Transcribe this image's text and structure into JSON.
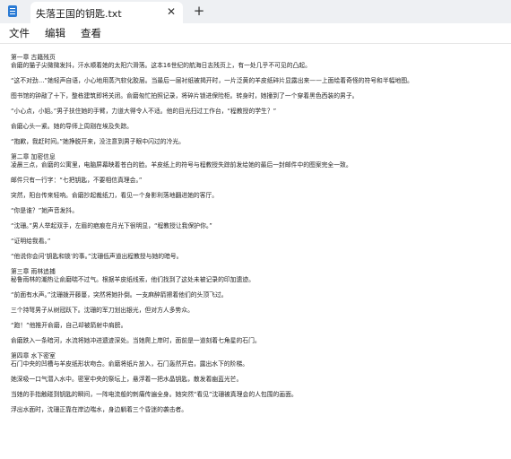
{
  "window": {
    "tab_title": "失落王国的钥匙.txt",
    "close_glyph": "✕",
    "new_tab_glyph": "+"
  },
  "menu": {
    "file": "文件",
    "edit": "编辑",
    "view": "查看"
  },
  "colors": {
    "titlebar": "#eef0f3",
    "app_icon": "#2b7bd4"
  },
  "icons": [
    "notepad-icon",
    "close-icon",
    "plus-icon"
  ],
  "document": {
    "lines": [
      "第一章 古籍残页",
      "俞磨的猫子尖微微发抖，汗水顺着她的太阳穴滑落。这本16世纪的航海日志残页上，有一处几乎不可见的凸起。",
      "“这不对劲…”她轻声自语，小心地用蒸汽软化胶层。当最后一层衬纸被揭开时，一片泛黄的羊皮纸碎片显露出来——上面绘着奇怪的符号和半幅地图。",
      "图书馆的钟敲了十下，整栋建筑即将关闭。俞磨匆忙拍照记录，将碎片锁进保险柜。转身时，她撞到了一个穿着黑色西装的男子。",
      "“小心点，小姐。”男子扶住她的手臂，力道大得令人不适。他的目光扫过工作台，“程教授的学生？”",
      "俞磨心头一紧。她的导师上周刚在埃及失踪。",
      "“抱歉，我赶时间。”她挣脱开来，没注意到男子眼中闪过的冷光。",
      "第二章 加密信息",
      "凌晨三点，俞磨的公寓里，电脑屏幕映着苍白的脸。羊皮纸上的符号与程教授失踪前发给她的最后一封邮件中的图案完全一致。",
      "邮件只有一行字：“七把钥匙，不要相信真理会。”",
      "突然，阳台传来轻响。俞磨抄起裁纸刀，看见一个身影利落地翻进她的客厅。",
      "“你是谁？”她声音发抖。",
      "“沈珊。”男人举起双手，左眉的疤痕在月光下很明显，“程教授让我保护你。”",
      "“证明给我看。”",
      "“他说你会问‘钥匙和锁’的事。”沈珊低声道出程教授与她的暗号。",
      "第三章 雨林追捕",
      "秘鲁雨林的潮热让俞磨喘不过气。根据羊皮纸线索，他们找到了这处未被记录的印加遗迹。",
      "“前面有水声。”沈珊拨开藤蔓，突然将她扑倒。一支麻醉箭擦着他们的头顶飞过。",
      "三个持弩男子从树冠跃下。沈珊的军刀划出银光，但对方人多势众。",
      "“跑！”他推开俞磨，自己却被箭射中肩膀。",
      "俞磨跌入一条暗河，水流将她冲进遗迹深处。当她爬上岸时，面前是一道刻着七角星的石门。",
      "第四章 水下密室",
      "石门中央的凹槽与羊皮纸形状吻合。俞磨将纸片放入，石门轰然开启，露出水下的阶梯。",
      "她深吸一口气潜入水中。密室中央的祭坛上，悬浮着一把水晶钥匙，散发着幽蓝光芒。",
      "当她的手指触碰到钥匙的瞬间，一阵电流般的刺痛传遍全身。她突然“看见”沈珊被真理会的人包围的画面。",
      "浮出水面时，沈珊正靠在岸边喘水，身边躺着三个昏迷的袭击者。"
    ]
  }
}
